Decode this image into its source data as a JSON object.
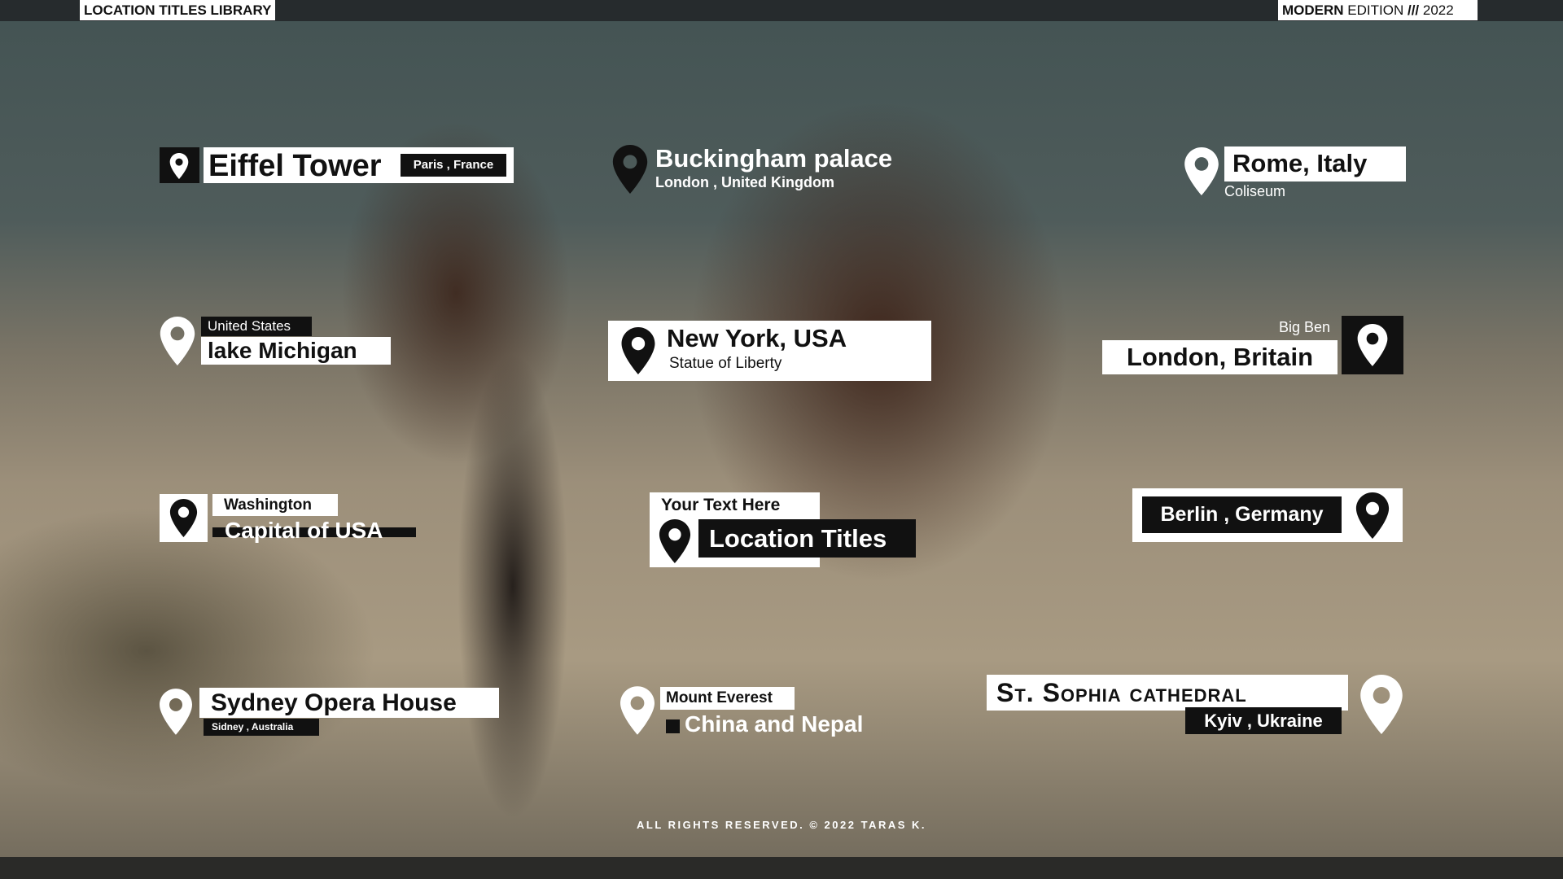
{
  "header": {
    "library_title": "LOCATION TITLES LIBRARY",
    "edition_bold": "MODERN",
    "edition_light": "EDITION",
    "edition_sep": "///",
    "edition_year": "2022"
  },
  "titles": {
    "eiffel": {
      "title": "Eiffel Tower",
      "tag": "Paris , France"
    },
    "buckingham": {
      "title": "Buckingham palace",
      "subtitle": "London , United Kingdom"
    },
    "rome": {
      "title": "Rome, Italy",
      "subtitle": "Coliseum"
    },
    "michigan": {
      "tag": "United States",
      "title": "lake Michigan"
    },
    "newyork": {
      "title": "New York, USA",
      "subtitle": "Statue of Liberty"
    },
    "london": {
      "tag": "Big Ben",
      "title": "London, Britain"
    },
    "washington": {
      "tag": "Washington",
      "title": "Capital of USA"
    },
    "center": {
      "tag": "Your Text Here",
      "title": "Location Titles"
    },
    "berlin": {
      "title": "Berlin , Germany"
    },
    "sydney": {
      "title": "Sydney Opera House",
      "tag": "Sidney , Australia"
    },
    "everest": {
      "tag": "Mount Everest",
      "title": "China and Nepal"
    },
    "sophia": {
      "title": "St. Sophia cathedral",
      "tag": "Kyiv , Ukraine"
    }
  },
  "footer": {
    "text": "ALL RIGHTS RESERVED. © 2022 TARAS K."
  },
  "colors": {
    "label_bg": "#ffffff",
    "label_dark": "#111111",
    "top_bar": "#262b2d"
  },
  "icons": {
    "pin": "map-pin-icon"
  }
}
